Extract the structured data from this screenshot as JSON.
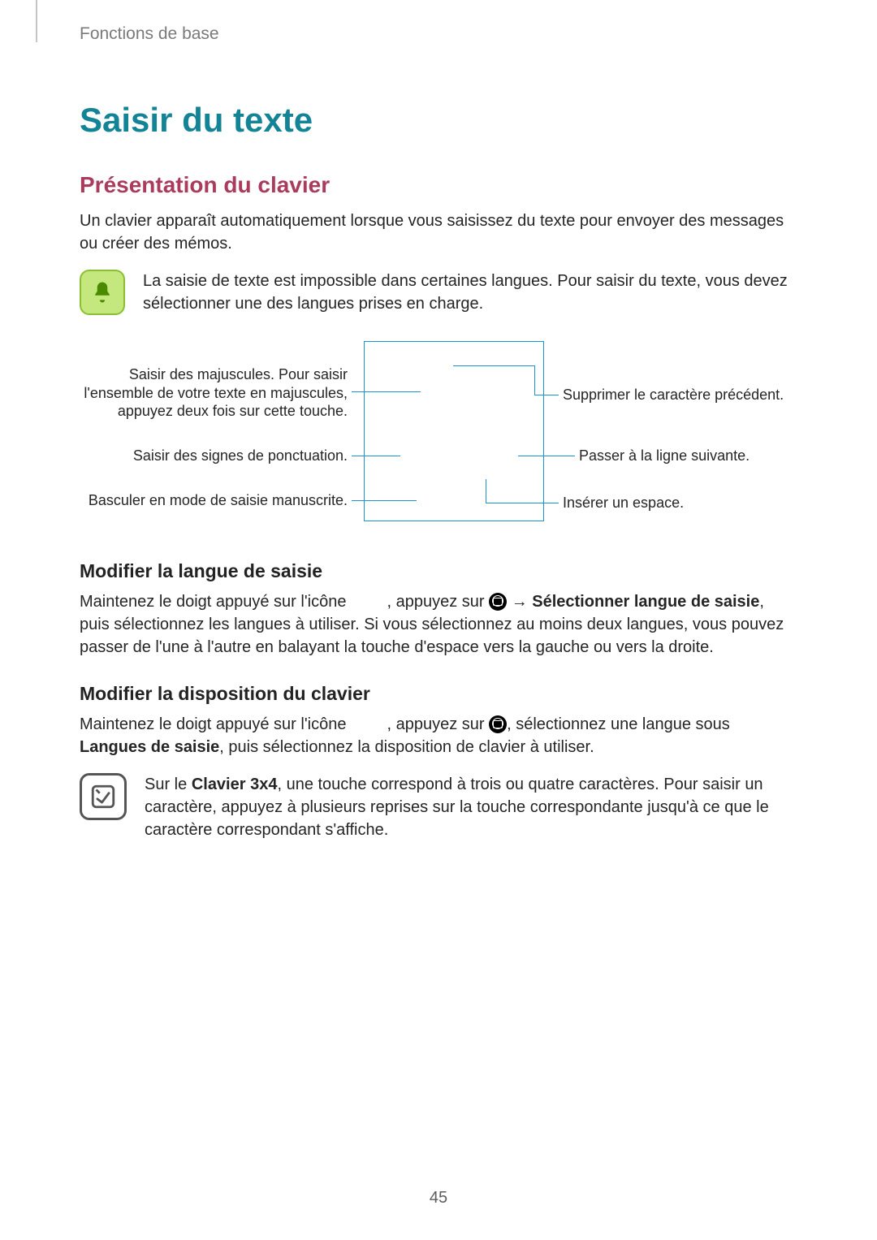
{
  "header": "Fonctions de base",
  "title": "Saisir du texte",
  "section1": {
    "heading": "Présentation du clavier",
    "intro": "Un clavier apparaît automatiquement lorsque vous saisissez du texte pour envoyer des messages ou créer des mémos.",
    "note": "La saisie de texte est impossible dans certaines langues. Pour saisir du texte, vous devez sélectionner une des langues prises en charge."
  },
  "callouts": {
    "l1": "Saisir des majuscules. Pour saisir l'ensemble de votre texte en majuscules, appuyez deux fois sur cette touche.",
    "l2": "Saisir des signes de ponctuation.",
    "l3": "Basculer en mode de saisie manuscrite.",
    "r1": "Supprimer le caractère précédent.",
    "r2": "Passer à la ligne suivante.",
    "r3": "Insérer un espace."
  },
  "sub1": {
    "heading": "Modifier la langue de saisie",
    "p_a": "Maintenez le doigt appuyé sur l'icône",
    "p_b": ", appuyez sur",
    "p_c": "→",
    "p_d": "Sélectionner langue de saisie",
    "p_e": ", puis sélectionnez les langues à utiliser. Si vous sélectionnez au moins deux langues, vous pouvez passer de l'une à l'autre en balayant la touche d'espace vers la gauche ou vers la droite."
  },
  "sub2": {
    "heading": "Modifier la disposition du clavier",
    "p_a": "Maintenez le doigt appuyé sur l'icône",
    "p_b": ", appuyez sur",
    "p_c": ", sélectionnez une langue sous",
    "p_d": "Langues de saisie",
    "p_e": ", puis sélectionnez la disposition de clavier à utiliser.",
    "note_a": "Sur le",
    "note_b": "Clavier 3x4",
    "note_c": ", une touche correspond à trois ou quatre caractères. Pour saisir un caractère, appuyez à plusieurs reprises sur la touche correspondante jusqu'à ce que le caractère correspondant s'affiche."
  },
  "page_number": "45"
}
